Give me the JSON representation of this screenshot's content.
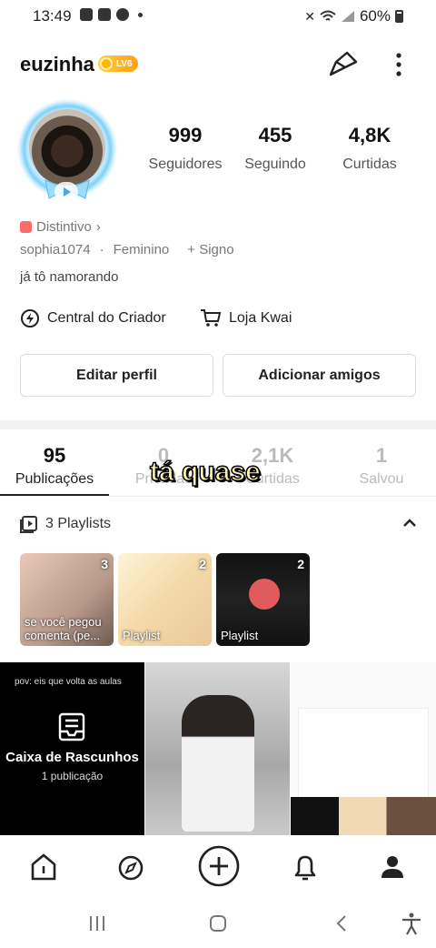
{
  "status_bar": {
    "time": "13:49",
    "battery": "60%"
  },
  "header": {
    "username": "euzinha",
    "level": "LV6"
  },
  "stats": [
    {
      "value": "999",
      "label": "Seguidores"
    },
    {
      "value": "455",
      "label": "Seguindo"
    },
    {
      "value": "4,8K",
      "label": "Curtidas"
    }
  ],
  "profile": {
    "badge_label": "Distintivo",
    "handle": "sophia1074",
    "gender": "Feminino",
    "sign": "+ Signo",
    "bio": "já tô namorando"
  },
  "links": {
    "creator": "Central do Criador",
    "shop": "Loja Kwai"
  },
  "buttons": {
    "edit": "Editar perfil",
    "add_friends": "Adicionar amigos"
  },
  "tabs": [
    {
      "count": "95",
      "label": "Publicações"
    },
    {
      "count": "0",
      "label": "Privadas"
    },
    {
      "count": "2,1K",
      "label": "Curtidas"
    },
    {
      "count": "1",
      "label": "Salvou"
    }
  ],
  "overlay_caption": "tá quase",
  "playlists": {
    "header": "3 Playlists",
    "items": [
      {
        "count": "3",
        "title": "se você pegou comenta (pe..."
      },
      {
        "count": "2",
        "title": "Playlist"
      },
      {
        "count": "2",
        "title": "Playlist"
      }
    ]
  },
  "grid": {
    "drafts_caption": "pov: eis que volta as aulas",
    "drafts_title": "Caixa de Rascunhos",
    "drafts_sub": "1 publicação"
  }
}
